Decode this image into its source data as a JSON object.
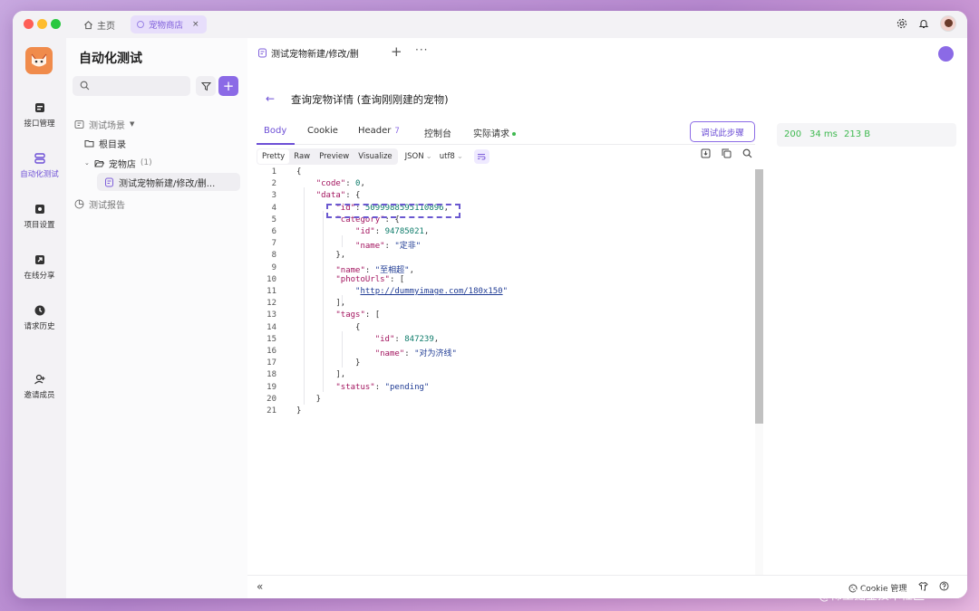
{
  "titlebar": {
    "home_tab": "主页",
    "shop_tab": "宠物商店",
    "close_glyph": "×"
  },
  "leftnav": {
    "items": [
      {
        "label": "接口管理",
        "icon": "api-icon"
      },
      {
        "label": "自动化测试",
        "icon": "automation-icon",
        "active": true
      },
      {
        "label": "项目设置",
        "icon": "settings-icon"
      },
      {
        "label": "在线分享",
        "icon": "share-icon"
      },
      {
        "label": "请求历史",
        "icon": "history-icon"
      },
      {
        "label": "邀请成员",
        "icon": "invite-icon"
      }
    ]
  },
  "tree": {
    "title": "自动化测试",
    "add_glyph": "+",
    "scenes_label": "测试场景",
    "root_label": "根目录",
    "folder_label": "宠物店",
    "folder_count": "(1)",
    "case_label": "测试宠物新建/修改/删...",
    "report_label": "测试报告"
  },
  "main": {
    "tab_title": "测试宠物新建/修改/删",
    "plus": "+",
    "more": "···",
    "back_glyph": "←",
    "request_title": "查询宠物详情 (查询刚刚建的宠物)",
    "subtabs": {
      "body": "Body",
      "cookie": "Cookie",
      "header": "Header",
      "header_count": "7",
      "console": "控制台",
      "actual": "实际请求"
    },
    "debug_button": "调试此步骤",
    "format": {
      "pretty": "Pretty",
      "raw": "Raw",
      "preview": "Preview",
      "visualize": "Visualize",
      "type": "JSON",
      "encoding": "utf8"
    },
    "line_numbers": [
      "1",
      "2",
      "3",
      "4",
      "5",
      "6",
      "7",
      "8",
      "9",
      "10",
      "11",
      "12",
      "13",
      "14",
      "15",
      "16",
      "17",
      "18",
      "19",
      "20",
      "21"
    ],
    "code": {
      "l1": "{",
      "l2_key": "\"code\"",
      "l2_val": "0",
      "l3_key": "\"data\"",
      "l4_key": "\"id\"",
      "l4_val": "5099988595110896",
      "l5_key": "\"category\"",
      "l6_key": "\"id\"",
      "l6_val": "94785021",
      "l7_key": "\"name\"",
      "l7_val": "\"定非\"",
      "l9_key": "\"name\"",
      "l9_val": "\"至相超\"",
      "l10_key": "\"photoUrls\"",
      "l11_val": "http://dummyimage.com/180x150",
      "l13_key": "\"tags\"",
      "l15_key": "\"id\"",
      "l15_val": "847239",
      "l16_key": "\"name\"",
      "l16_val": "\"对为济线\"",
      "l19_key": "\"status\"",
      "l19_val": "\"pending\""
    },
    "response": {
      "status": "200",
      "time": "34 ms",
      "size": "213 B"
    },
    "bottom": {
      "collapse": "«",
      "cookie_manager": "Cookie 管理"
    }
  },
  "watermark": "@稀土掘金技术社区",
  "colors": {
    "accent": "#8b6ae6",
    "status_ok": "#3fb950",
    "json_key": "#a3155f",
    "json_string": "#1f3b94",
    "json_number": "#0d7b6a"
  }
}
